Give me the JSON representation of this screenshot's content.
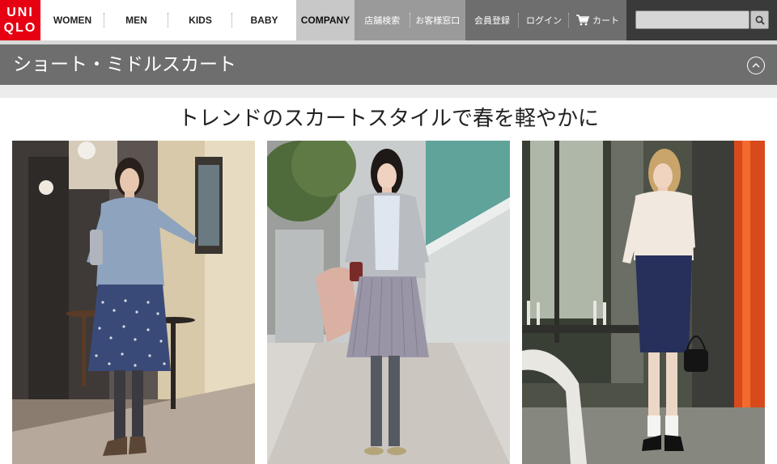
{
  "header": {
    "logo_text": "UNI\nQLO",
    "logo_lines": [
      "UNI",
      "QLO"
    ],
    "brand_color": "#e60012",
    "nav_items": [
      "WOMEN",
      "MEN",
      "KIDS",
      "BABY"
    ],
    "company": "COMPANY",
    "store_links": [
      "店舗検索",
      "お客様窓口"
    ],
    "member_links": [
      "会員登録",
      "ログイン"
    ],
    "cart_label": "カート",
    "cart_icon": "cart-icon",
    "search": {
      "value": "",
      "icon": "search-icon"
    }
  },
  "category": {
    "title": "ショート・ミドルスカート",
    "collapse_icon": "chevron-up-icon"
  },
  "main": {
    "headline": "トレンドのスカートスタイルで春を軽やかに",
    "photos": [
      {
        "top": "light blue sweater",
        "skirt": "navy polka-dot skirt",
        "skirt_color": "#3a4a78",
        "top_color": "#8ea3be"
      },
      {
        "top": "grey cardigan",
        "skirt": "grey pleated skirt",
        "skirt_color": "#9a95a6",
        "top_color": "#b9bcc0"
      },
      {
        "top": "cream knit",
        "skirt": "navy pencil skirt",
        "skirt_color": "#27305a",
        "top_color": "#f1e8df"
      }
    ]
  }
}
